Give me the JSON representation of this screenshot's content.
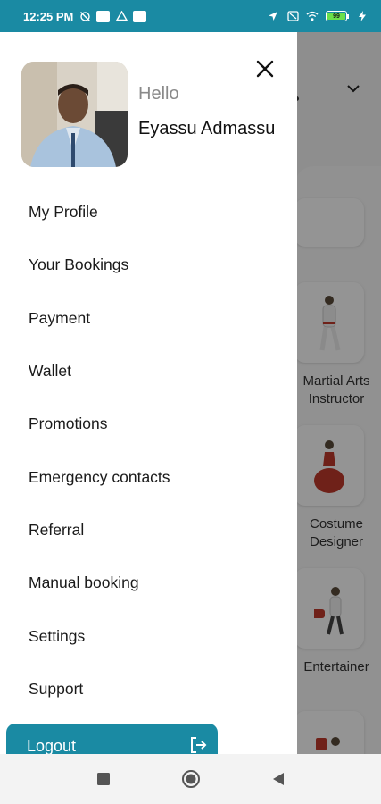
{
  "status_bar": {
    "time": "12:25 PM",
    "battery_level": "99",
    "icons": [
      "sync-off-icon",
      "notification-app-icon",
      "drive-icon",
      "notification-app-icon",
      "location-arrow-icon",
      "sim-icon",
      "wifi-icon",
      "battery-icon",
      "charging-icon"
    ]
  },
  "drawer": {
    "greeting": "Hello",
    "user_name": "Eyassu Admassu",
    "menu_items": [
      {
        "label": "My Profile"
      },
      {
        "label": "Your Bookings"
      },
      {
        "label": "Payment"
      },
      {
        "label": "Wallet"
      },
      {
        "label": "Promotions"
      },
      {
        "label": "Emergency contacts"
      },
      {
        "label": "Referral"
      },
      {
        "label": "Manual booking"
      },
      {
        "label": "Settings"
      },
      {
        "label": "Support"
      }
    ],
    "logout_label": "Logout"
  },
  "background": {
    "categories": [
      {
        "label_line1": "Martial Arts",
        "label_line2": "Instructor"
      },
      {
        "label_line1": "Costume",
        "label_line2": "Designer"
      },
      {
        "label_line1": "Entertainer",
        "label_line2": ""
      }
    ]
  },
  "colors": {
    "primary": "#1a8aa3",
    "drawer_bg": "#ffffff",
    "greeting_gray": "#8a8a8a"
  }
}
